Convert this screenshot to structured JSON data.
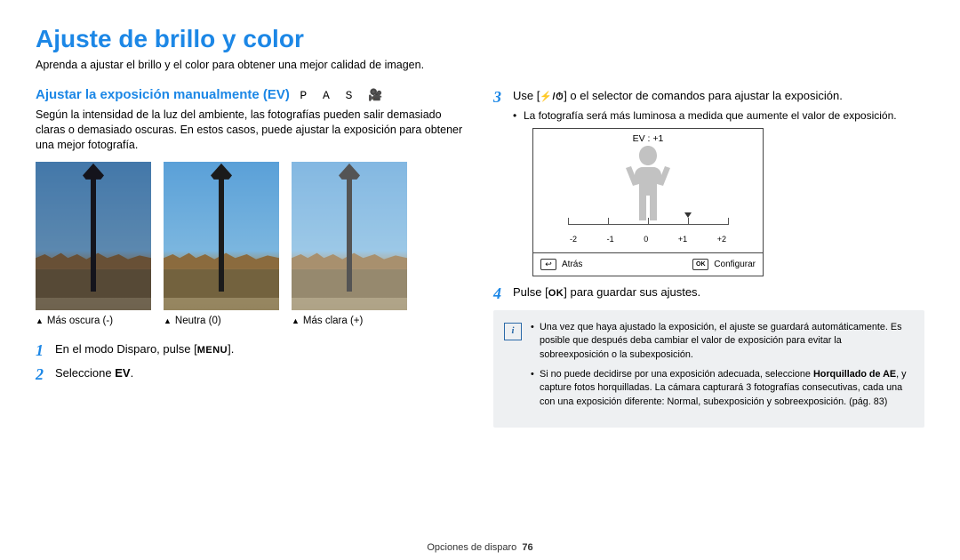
{
  "title": "Ajuste de brillo y color",
  "intro": "Aprenda a ajustar el brillo y el color para obtener una mejor calidad de imagen.",
  "section_heading": "Ajustar la exposición manualmente (EV)",
  "mode_icons": "P A S 🎥",
  "desc": "Según la intensidad de la luz del ambiente, las fotografías pueden salir demasiado claras o demasiado oscuras. En estos casos, puede ajustar la exposición para obtener una mejor fotografía.",
  "photos": [
    {
      "caption": "Más oscura (-)"
    },
    {
      "caption": "Neutra (0)"
    },
    {
      "caption": "Más clara (+)"
    }
  ],
  "steps_left": [
    {
      "n": "1",
      "text_a": "En el modo Disparo, pulse [",
      "key": "MENU",
      "text_b": "]."
    },
    {
      "n": "2",
      "text_a": "Seleccione ",
      "bold": "EV",
      "text_b": "."
    }
  ],
  "steps_right": [
    {
      "n": "3",
      "text_a": "Use [",
      "icons": "⚡/⏱",
      "text_b": "] o el selector de comandos para ajustar la exposición.",
      "sub": "La fotografía será más luminosa a medida que aumente el valor de exposición."
    },
    {
      "n": "4",
      "text_a": "Pulse [",
      "key": "OK",
      "text_b": "] para guardar sus ajustes."
    }
  ],
  "preview": {
    "ev_label": "EV : +1",
    "ticks": [
      "-2",
      "-1",
      "0",
      "+1",
      "+2"
    ],
    "back_icon": "↩",
    "back_label": "Atrás",
    "ok_icon": "OK",
    "ok_label": "Configurar"
  },
  "note": {
    "items": [
      "Una vez que haya ajustado la exposición, el ajuste se guardará automáticamente. Es posible que después deba cambiar el valor de exposición para evitar la sobreexposición o la subexposición.",
      {
        "pre": "Si no puede decidirse por una exposición adecuada, seleccione ",
        "bold": "Horquillado de AE",
        "post": ", y capture fotos horquilladas. La cámara capturará 3 fotografías consecutivas, cada una con una exposición diferente: Normal, subexposición y sobreexposición. (pág. 83)"
      }
    ]
  },
  "footer": {
    "section": "Opciones de disparo",
    "page": "76"
  }
}
